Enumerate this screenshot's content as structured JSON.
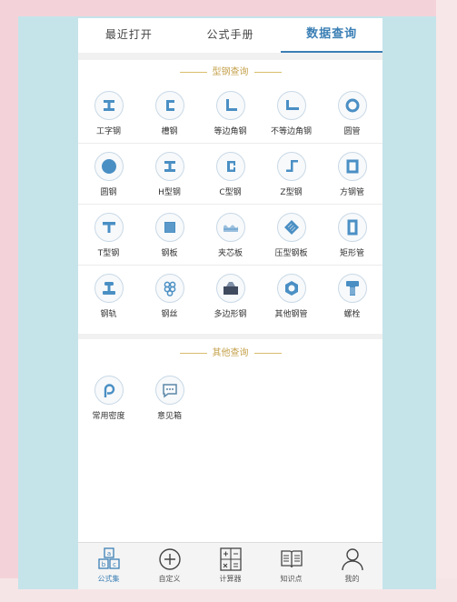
{
  "tabs": [
    {
      "label": "最近打开",
      "active": false
    },
    {
      "label": "公式手册",
      "active": false
    },
    {
      "label": "数据查询",
      "active": true
    }
  ],
  "sections": {
    "steel": {
      "title": "型钢查询",
      "items": [
        {
          "label": "工字钢",
          "icon": "i-beam-icon"
        },
        {
          "label": "槽钢",
          "icon": "channel-steel-icon"
        },
        {
          "label": "等边角钢",
          "icon": "equal-angle-icon"
        },
        {
          "label": "不等边角钢",
          "icon": "unequal-angle-icon"
        },
        {
          "label": "圆管",
          "icon": "round-pipe-icon"
        },
        {
          "label": "圆钢",
          "icon": "round-bar-icon"
        },
        {
          "label": "H型钢",
          "icon": "h-beam-icon"
        },
        {
          "label": "C型钢",
          "icon": "c-section-icon"
        },
        {
          "label": "Z型钢",
          "icon": "z-section-icon"
        },
        {
          "label": "方钢管",
          "icon": "square-tube-icon"
        },
        {
          "label": "T型钢",
          "icon": "t-section-icon"
        },
        {
          "label": "钢板",
          "icon": "steel-plate-icon"
        },
        {
          "label": "夹芯板",
          "icon": "sandwich-panel-icon"
        },
        {
          "label": "压型钢板",
          "icon": "profiled-sheet-icon"
        },
        {
          "label": "矩形管",
          "icon": "rect-tube-icon"
        },
        {
          "label": "钢轨",
          "icon": "rail-icon"
        },
        {
          "label": "钢丝",
          "icon": "steel-wire-icon"
        },
        {
          "label": "多边形钢",
          "icon": "polygon-steel-icon"
        },
        {
          "label": "其他钢管",
          "icon": "other-pipe-icon"
        },
        {
          "label": "螺栓",
          "icon": "bolt-icon"
        }
      ]
    },
    "other": {
      "title": "其他查询",
      "items": [
        {
          "label": "常用密度",
          "icon": "density-icon"
        },
        {
          "label": "意见箱",
          "icon": "feedback-icon"
        }
      ]
    }
  },
  "bottom_nav": [
    {
      "label": "公式集",
      "icon": "formula-set-icon",
      "active": true
    },
    {
      "label": "自定义",
      "icon": "custom-add-icon",
      "active": false
    },
    {
      "label": "计算器",
      "icon": "calculator-icon",
      "active": false
    },
    {
      "label": "知识点",
      "icon": "knowledge-book-icon",
      "active": false
    },
    {
      "label": "我的",
      "icon": "profile-icon",
      "active": false
    }
  ],
  "colors": {
    "accent": "#3b7fb5",
    "icon_blue": "#4a8fc4",
    "section_gold": "#c4a24c",
    "frame_bg": "#c5e4ea",
    "outer_bg": "#f3d3d9"
  }
}
